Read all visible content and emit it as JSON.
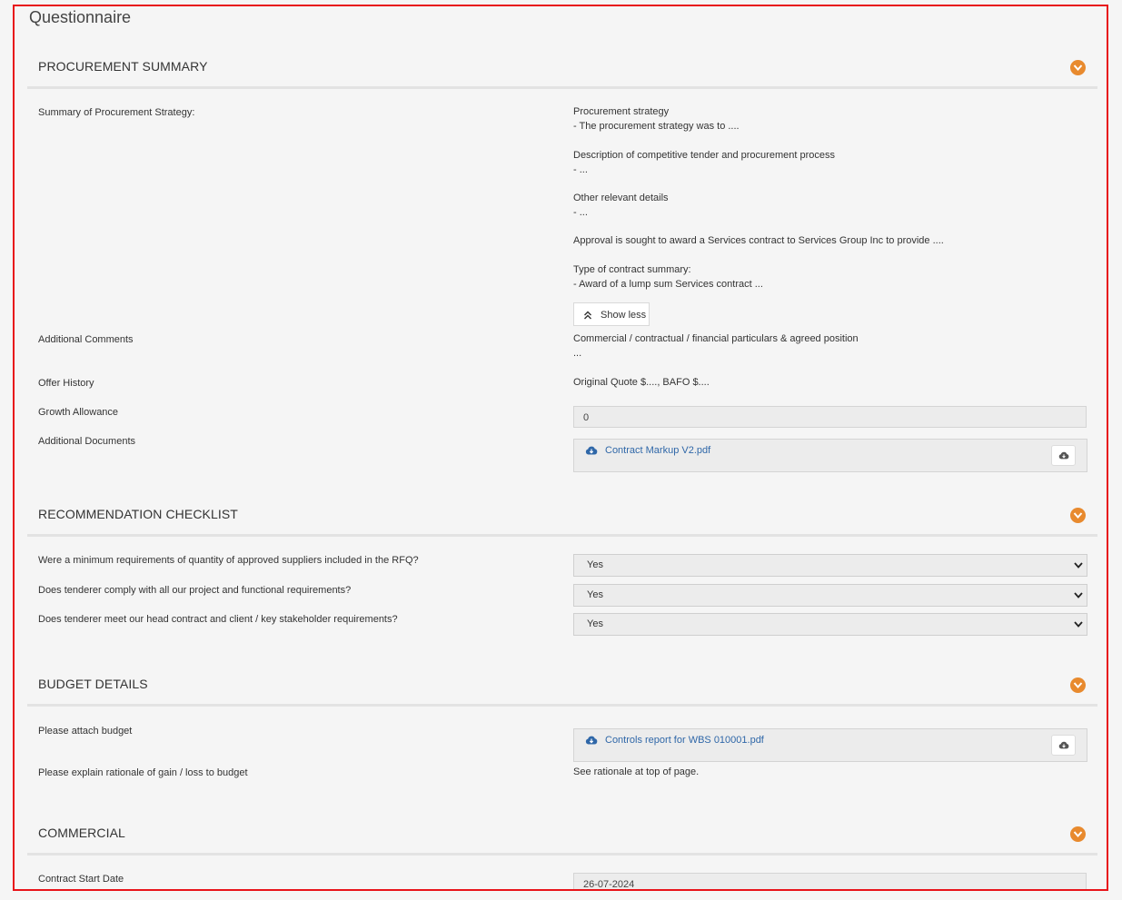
{
  "page_title": "Questionnaire",
  "sections": {
    "procurement": {
      "title": "PROCUREMENT SUMMARY",
      "summary_label": "Summary of Procurement Strategy:",
      "summary_lines": [
        "Procurement strategy",
        "- The procurement strategy was to ....",
        "",
        "Description of competitive tender and procurement process",
        "- ...",
        "",
        "Other relevant details",
        "- ...",
        "",
        "Approval is sought to award a Services contract to Services Group Inc to provide ....",
        "",
        "Type of contract summary:",
        "- Award of a lump sum Services contract ..."
      ],
      "show_less_label": "Show less",
      "additional_comments_label": "Additional Comments",
      "additional_comments_lines": [
        "Commercial / contractual / financial particulars & agreed position",
        "..."
      ],
      "offer_history_label": "Offer History",
      "offer_history_value": "Original Quote $...., BAFO $....",
      "growth_allowance_label": "Growth Allowance",
      "growth_allowance_value": "0",
      "additional_documents_label": "Additional Documents",
      "additional_document_file": "Contract Markup V2.pdf"
    },
    "checklist": {
      "title": "RECOMMENDATION CHECKLIST",
      "questions": [
        {
          "label": "Were a minimum requirements of quantity of approved suppliers included in the RFQ?",
          "value": "Yes"
        },
        {
          "label": "Does tenderer comply with all our project and functional requirements?",
          "value": "Yes"
        },
        {
          "label": "Does tenderer meet our head contract and client / key stakeholder requirements?",
          "value": "Yes"
        }
      ]
    },
    "budget": {
      "title": "BUDGET DETAILS",
      "attach_label": "Please attach budget",
      "attach_file": "Controls report for WBS 010001.pdf",
      "rationale_label": "Please explain rationale of gain / loss to budget",
      "rationale_value": "See rationale at top of page."
    },
    "commercial": {
      "title": "COMMERCIAL",
      "start_date_label": "Contract Start Date",
      "start_date_value": "26-07-2024"
    }
  },
  "colors": {
    "accent": "#e88a2e",
    "link": "#2f67a8",
    "frame_border": "#e8141a"
  },
  "icons": {
    "section_toggle": "chevron-down-icon",
    "file": "cloud-download-icon",
    "show_less": "double-chevron-up-icon",
    "select": "chevron-down-icon"
  }
}
